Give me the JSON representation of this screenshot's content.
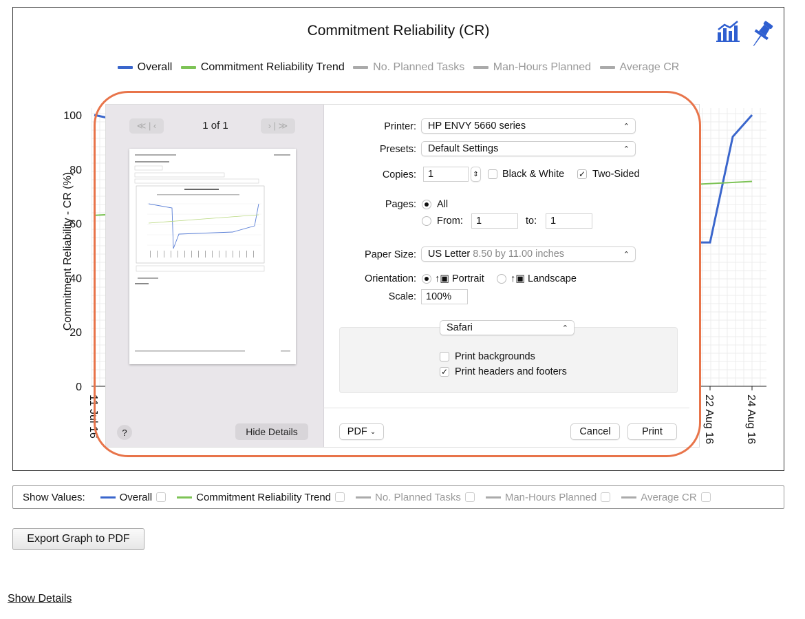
{
  "chart": {
    "title": "Commitment Reliability (CR)",
    "ylabel": "Commitment Reliability - CR (%)",
    "legend": [
      {
        "label": "Overall",
        "color": "#3a66cc",
        "active": true
      },
      {
        "label": "Commitment Reliability Trend",
        "color": "#7dc356",
        "active": true
      },
      {
        "label": "No. Planned Tasks",
        "color": "#aaaaaa",
        "active": false
      },
      {
        "label": "Man-Hours Planned",
        "color": "#aaaaaa",
        "active": false
      },
      {
        "label": "Average CR",
        "color": "#aaaaaa",
        "active": false
      }
    ],
    "icons": [
      "bar-chart-icon",
      "pin-icon"
    ]
  },
  "chart_data": {
    "type": "line",
    "title": "Commitment Reliability (CR)",
    "ylabel": "Commitment Reliability - CR (%)",
    "ylim": [
      0,
      100
    ],
    "yticks": [
      0,
      20,
      40,
      60,
      80,
      100
    ],
    "grid": true,
    "legend_position": "top",
    "x_ticks_visible": [
      "11 Jul 16",
      "22 Aug 16",
      "24 Aug 16"
    ],
    "series": [
      {
        "name": "Overall",
        "color": "#3a66cc",
        "points_visible": [
          {
            "x": "11 Jul 16",
            "y": 100
          },
          {
            "x": "21 Aug 16",
            "y": 53
          },
          {
            "x": "22 Aug 16",
            "y": 53
          },
          {
            "x": "23 Aug 16",
            "y": 92
          },
          {
            "x": "24 Aug 16",
            "y": 100
          }
        ]
      },
      {
        "name": "Commitment Reliability Trend",
        "color": "#7dc356",
        "points_visible": [
          {
            "x": "11 Jul 16",
            "y": 63
          },
          {
            "x": "24 Aug 16",
            "y": 75.5
          }
        ]
      }
    ]
  },
  "print_dialog": {
    "pager": {
      "first_prev": "≪ | ‹",
      "count": "1 of 1",
      "next_last": "› | ≫"
    },
    "help": "?",
    "hide_details": "Hide Details",
    "printer_label": "Printer:",
    "printer_value": "HP ENVY 5660 series",
    "presets_label": "Presets:",
    "presets_value": "Default Settings",
    "copies_label": "Copies:",
    "copies_value": "1",
    "bw_label": "Black & White",
    "two_sided_label": "Two-Sided",
    "pages_label": "Pages:",
    "pages_all": "All",
    "pages_from": "From:",
    "from_value": "1",
    "pages_to": "to:",
    "to_value": "1",
    "paper_label": "Paper Size:",
    "paper_value": "US Letter",
    "paper_dims": "8.50 by 11.00 inches",
    "orientation_label": "Orientation:",
    "portrait": "Portrait",
    "landscape": "Landscape",
    "scale_label": "Scale:",
    "scale_value": "100%",
    "app_popup": "Safari",
    "print_bg": "Print backgrounds",
    "print_hf": "Print headers and footers",
    "pdf": "PDF",
    "cancel": "Cancel",
    "print": "Print"
  },
  "show_values": {
    "label": "Show Values:",
    "items": [
      {
        "label": "Overall",
        "color": "#3a66cc",
        "active": true
      },
      {
        "label": "Commitment Reliability Trend",
        "color": "#7dc356",
        "active": true
      },
      {
        "label": "No. Planned Tasks",
        "color": "#aaaaaa",
        "active": false
      },
      {
        "label": "Man-Hours Planned",
        "color": "#aaaaaa",
        "active": false
      },
      {
        "label": "Average CR",
        "color": "#aaaaaa",
        "active": false
      }
    ]
  },
  "export_button": "Export Graph to PDF",
  "show_details": "Show Details",
  "highlight_color": "#e8744a"
}
